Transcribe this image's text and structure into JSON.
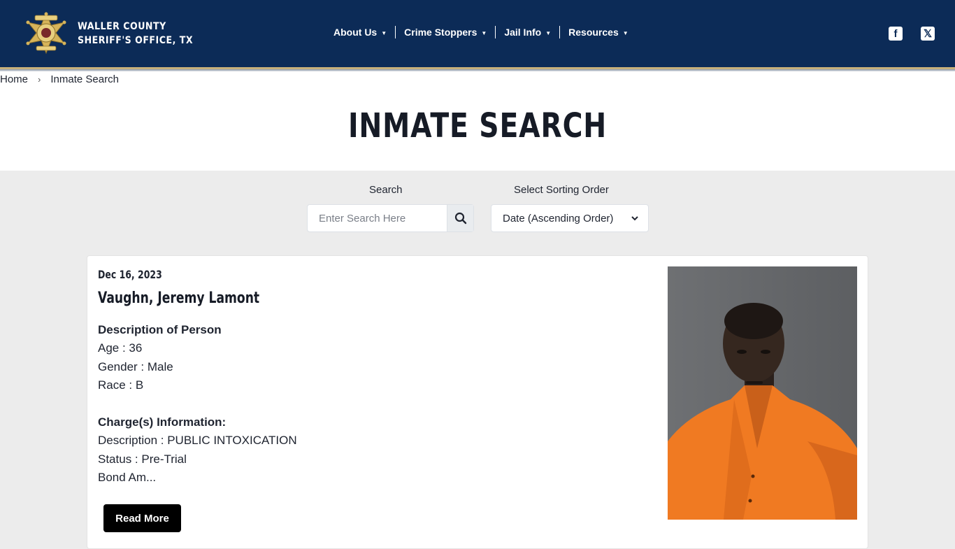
{
  "header": {
    "brand_line1": "WALLER COUNTY",
    "brand_line2": "SHERIFF'S OFFICE, TX",
    "logo_icon": "sheriff-star-badge-icon",
    "nav": [
      {
        "label": "About Us"
      },
      {
        "label": "Crime Stoppers"
      },
      {
        "label": "Jail Info"
      },
      {
        "label": "Resources"
      }
    ],
    "social": [
      {
        "icon": "facebook-icon"
      },
      {
        "icon": "x-twitter-icon"
      }
    ],
    "colors": {
      "navy": "#0c2b57",
      "gold": "#c8b07a"
    }
  },
  "breadcrumb": {
    "home": "Home",
    "separator": "›",
    "current": "Inmate Search"
  },
  "page": {
    "title": "INMATE SEARCH"
  },
  "search": {
    "label": "Search",
    "placeholder": "Enter Search Here",
    "value": "",
    "button_icon": "search-icon"
  },
  "sort": {
    "label": "Select Sorting Order",
    "selected": "Date (Ascending Order)"
  },
  "inmate": {
    "date": "Dec 16, 2023",
    "name": "Vaughn, Jeremy Lamont",
    "description_heading": "Description of Person",
    "age": "Age : 36",
    "gender": "Gender : Male",
    "race": "Race : B",
    "charges_heading": "Charge(s) Information:",
    "charge_description": "Description : PUBLIC INTOXICATION",
    "charge_status": "Status : Pre-Trial",
    "bond_truncated": "Bond Am...",
    "read_more": "Read More",
    "photo_icon": "mugshot-photo"
  }
}
